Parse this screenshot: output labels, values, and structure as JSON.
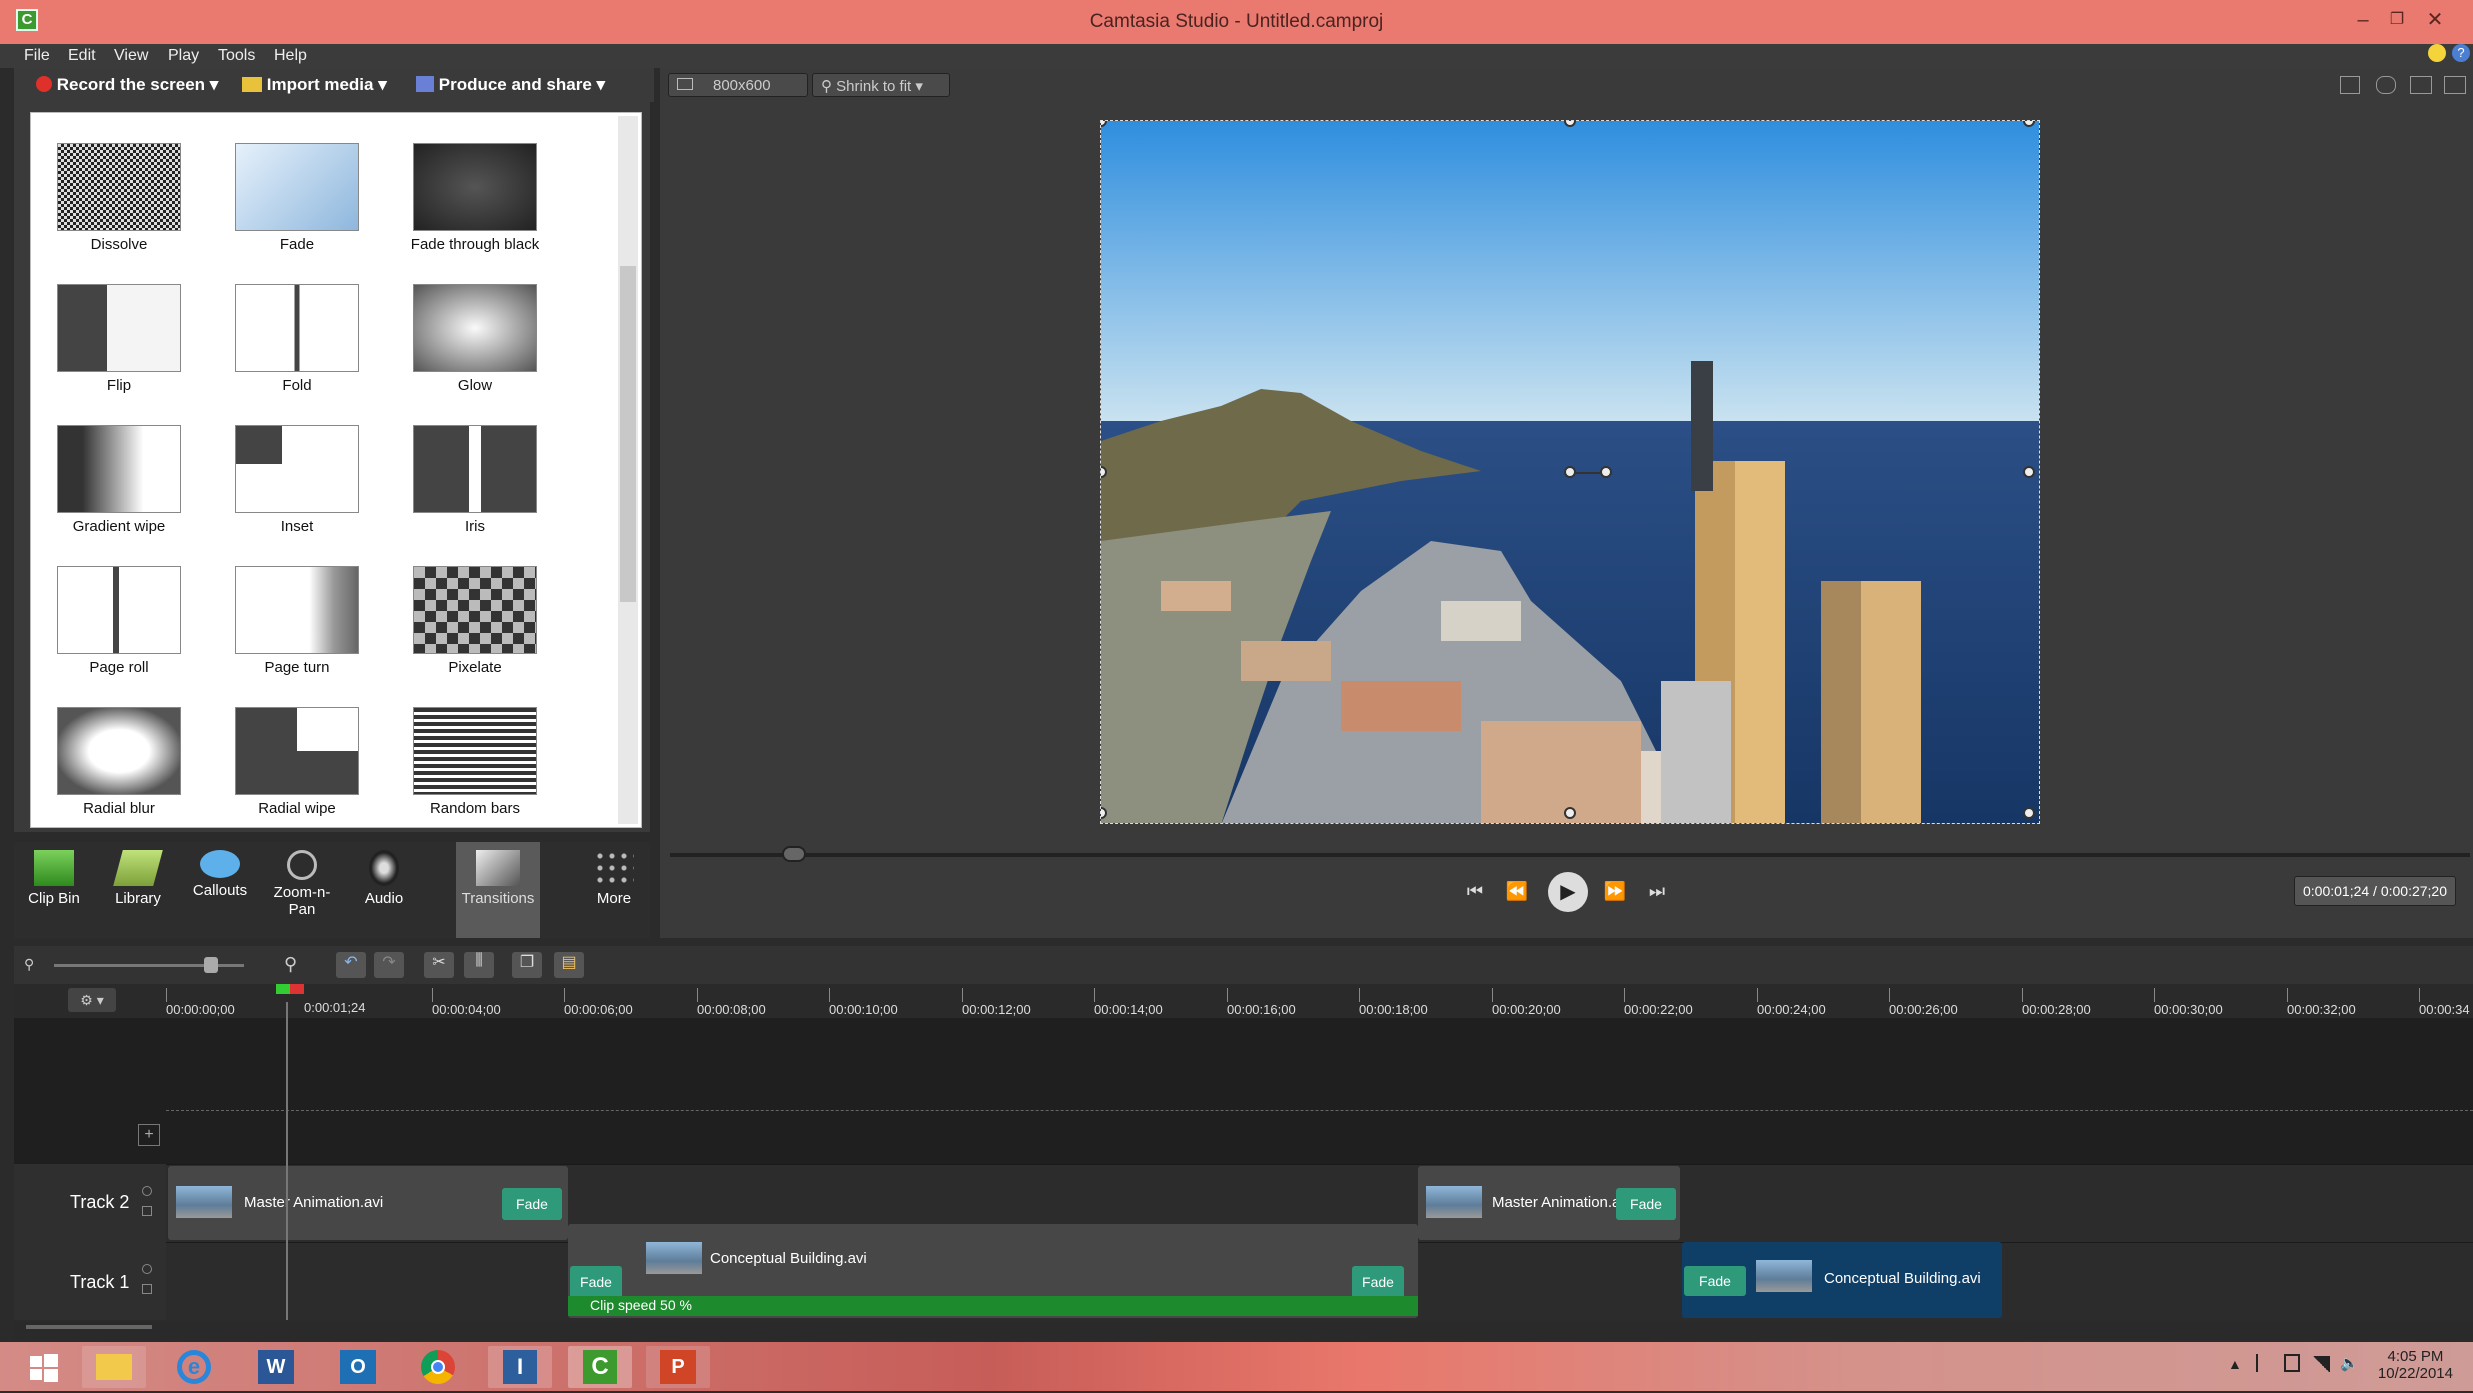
{
  "window": {
    "title": "Camtasia Studio - Untitled.camproj"
  },
  "menu": [
    "File",
    "Edit",
    "View",
    "Play",
    "Tools",
    "Help"
  ],
  "toolbar": {
    "record_label": "Record the screen",
    "import_label": "Import media",
    "produce_label": "Produce and share"
  },
  "preview_toolbar": {
    "size_value": "800x600",
    "zoom_value": "Shrink to fit"
  },
  "transitions": [
    {
      "label": "Dissolve"
    },
    {
      "label": "Fade"
    },
    {
      "label": "Fade through black"
    },
    {
      "label": "Flip"
    },
    {
      "label": "Fold"
    },
    {
      "label": "Glow"
    },
    {
      "label": "Gradient wipe"
    },
    {
      "label": "Inset"
    },
    {
      "label": "Iris"
    },
    {
      "label": "Page roll"
    },
    {
      "label": "Page turn"
    },
    {
      "label": "Pixelate"
    },
    {
      "label": "Radial blur"
    },
    {
      "label": "Radial wipe"
    },
    {
      "label": "Random bars"
    }
  ],
  "tabs": [
    {
      "label": "Clip Bin"
    },
    {
      "label": "Library"
    },
    {
      "label": "Callouts"
    },
    {
      "label": "Zoom-n-\nPan"
    },
    {
      "label": "Audio"
    },
    {
      "label": "Transitions"
    },
    {
      "label": "More"
    }
  ],
  "playback": {
    "timecode": "0:00:01;24 / 0:00:27;20"
  },
  "timeline": {
    "playhead_label": "0:00:01;24",
    "ruler": [
      "00:00:00;00",
      "00:00:04;00",
      "00:00:06;00",
      "00:00:08;00",
      "00:00:10;00",
      "00:00:12;00",
      "00:00:14;00",
      "00:00:16;00",
      "00:00:18;00",
      "00:00:20;00",
      "00:00:22;00",
      "00:00:24;00",
      "00:00:26;00",
      "00:00:28;00",
      "00:00:30;00",
      "00:00:32;00",
      "00:00:34"
    ],
    "tracks": [
      {
        "name": "Track 2"
      },
      {
        "name": "Track 1"
      }
    ],
    "clips": {
      "t2_clip1": "Master Animation.avi",
      "t2_clip2": "Master Animation.avi",
      "t1_clip1": "Conceptual Building.avi",
      "t1_clip2": "Conceptual Building.avi",
      "fade": "Fade",
      "clip_speed": "Clip speed 50 %"
    }
  },
  "taskbar": {
    "time": "4:05 PM",
    "date": "10/22/2014"
  },
  "colors": {
    "titlebar": "#ea7a70",
    "fade": "#2e9a7a",
    "selected_clip": "#0f3e66",
    "clip_speed": "#1e8a2e"
  }
}
